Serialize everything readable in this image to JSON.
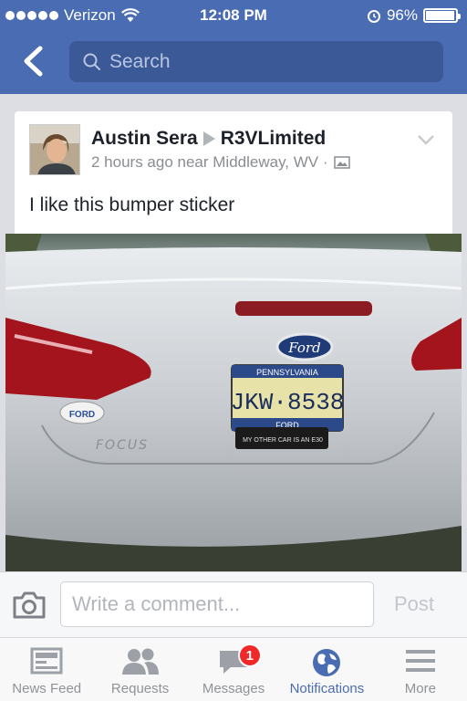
{
  "status_bar": {
    "carrier": "Verizon",
    "time": "12:08 PM",
    "battery": "96%",
    "battery_level": 0.96
  },
  "nav": {
    "search_placeholder": "Search"
  },
  "post": {
    "author": "Austin Sera",
    "target": "R3VLimited",
    "meta": "2 hours ago near Middleway, WV ·",
    "text": "I like this bumper sticker",
    "photo": {
      "plate_state": "PENNSYLVANIA",
      "plate_number": "JKW·8538",
      "plate_frame": "FORD",
      "sticker_text": "MY OTHER CAR IS AN E30",
      "emblem": "Ford",
      "badge_text": "FOCUS",
      "left_sticker": "FORD"
    }
  },
  "comment": {
    "placeholder": "Write a comment...",
    "post_label": "Post"
  },
  "tabs": [
    {
      "label": "News Feed",
      "icon": "news-feed-icon"
    },
    {
      "label": "Requests",
      "icon": "friend-requests-icon"
    },
    {
      "label": "Messages",
      "icon": "messages-icon",
      "badge": "1"
    },
    {
      "label": "Notifications",
      "icon": "globe-icon",
      "active": true
    },
    {
      "label": "More",
      "icon": "menu-icon"
    }
  ],
  "colors": {
    "brand": "#4a6cb2",
    "badge": "#f02828"
  }
}
